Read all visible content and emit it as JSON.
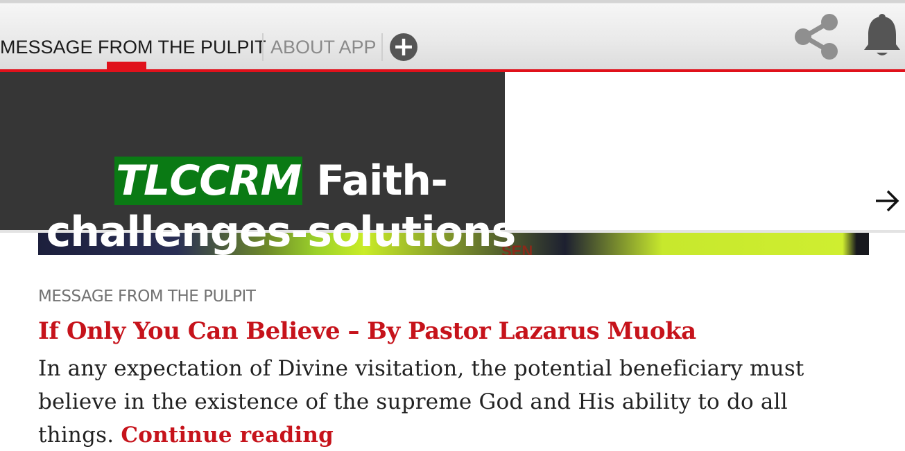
{
  "tabs": {
    "active_label": "MESSAGE FROM THE PULPIT",
    "about_label": "ABOUT APP",
    "add_icon": "plus-circle-icon",
    "accent": "#e0111b"
  },
  "header_actions": {
    "share_icon": "share-icon",
    "notifications_icon": "bell-icon"
  },
  "slider": {
    "title_highlight": "TLCCRM",
    "title_rest": " Faith-challenges-solutions",
    "highlight_color": "#0a7a14",
    "image_text": "SEN",
    "next_icon": "arrow-right-icon"
  },
  "article": {
    "category": "MESSAGE FROM THE PULPIT",
    "title": "If Only You Can Believe – By Pastor Lazarus Muoka",
    "excerpt": "In any expectation of Divine visitation, the potential beneficiary must believe in the existence of the supreme God and His ability to do all things. ",
    "continue_label": "Continue reading",
    "link_color": "#c6131b"
  }
}
